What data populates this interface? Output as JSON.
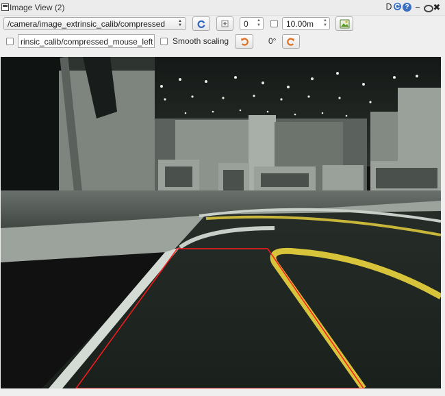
{
  "window": {
    "title": "Image View (2)",
    "controls": [
      "D",
      "reload",
      "help",
      "minimize",
      "restore",
      "close"
    ]
  },
  "toolbar": {
    "topic": "/camera/image_extrinsic_calib/compressed",
    "spin_value": "0",
    "max_range": "10.00m",
    "mouse_topic": "rinsic_calib/compressed_mouse_left",
    "smooth_scaling_label": "Smooth scaling",
    "smooth_scaling_checked": false,
    "rotation_label": "0°",
    "icons": [
      "refresh-icon",
      "zoom-fit-icon",
      "save-image-icon",
      "rotate-left-icon",
      "rotate-right-icon"
    ]
  },
  "colors": {
    "overlay_line": "#ff1a1a",
    "track": "#1c221e",
    "yellow_line": "#d8c43a"
  }
}
